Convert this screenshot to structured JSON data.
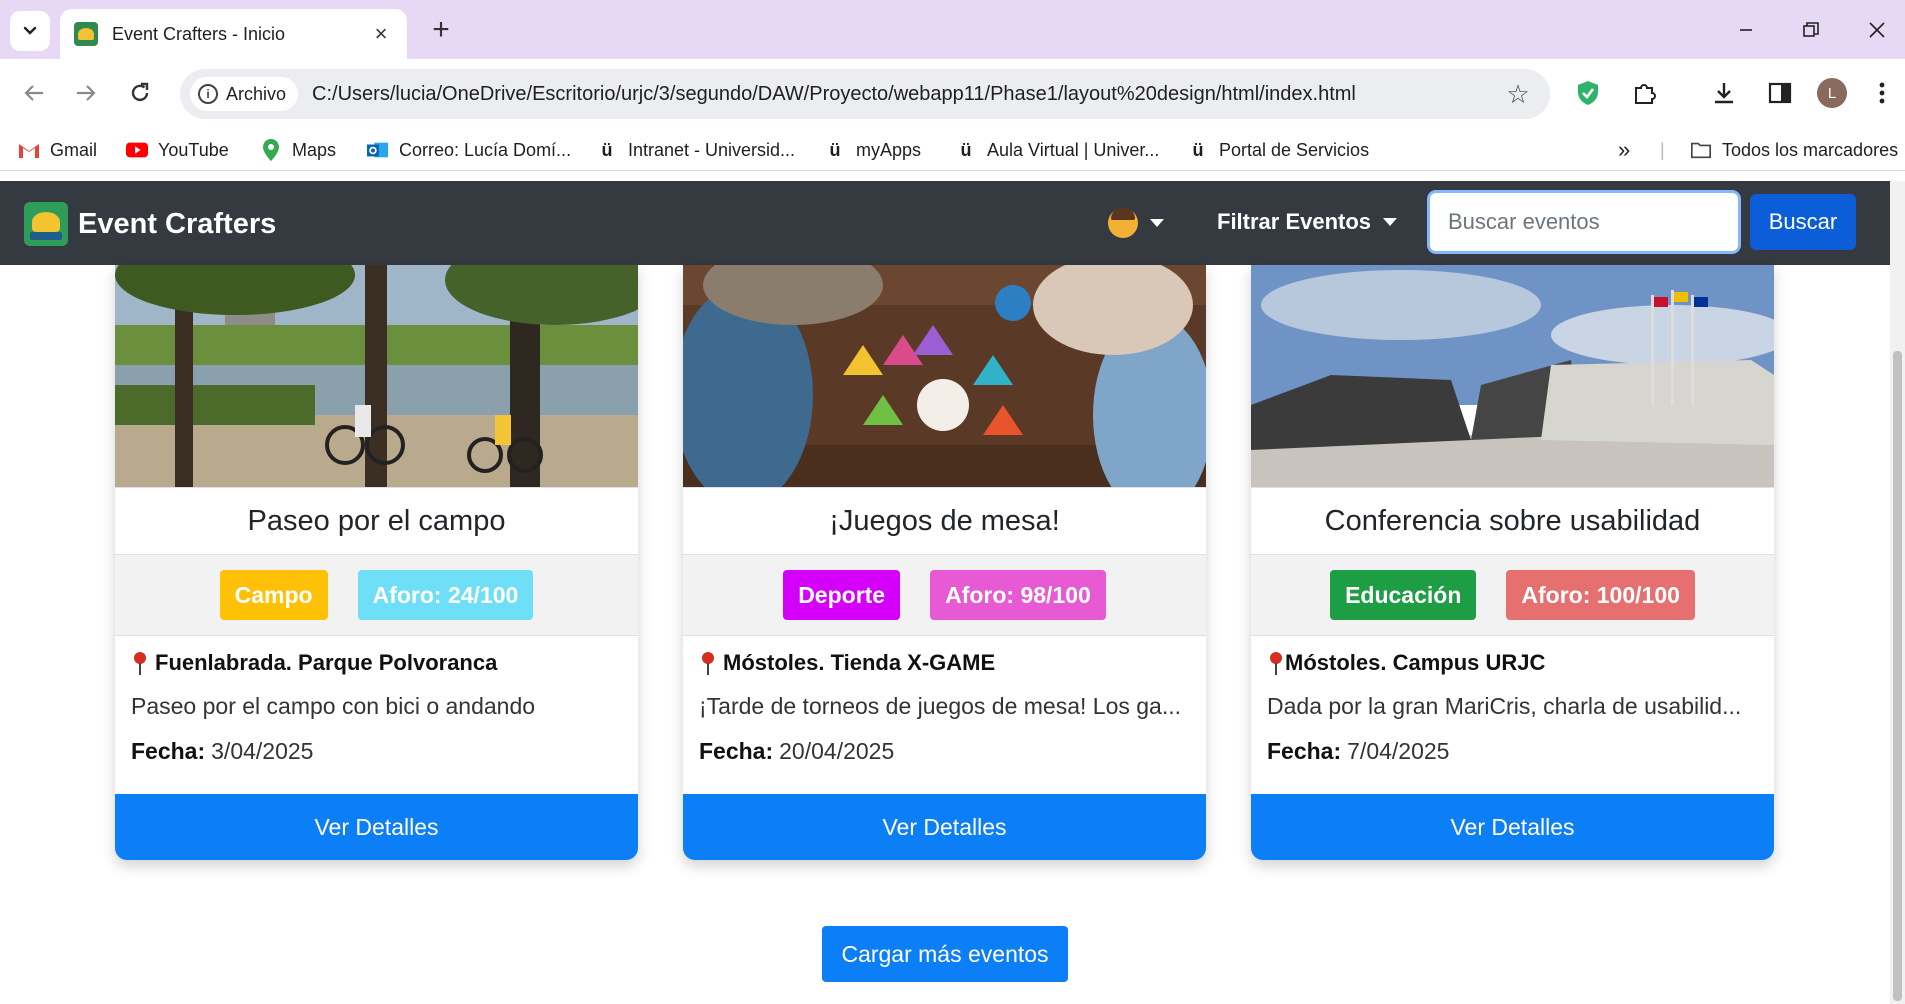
{
  "browser": {
    "tab_title": "Event Crafters - Inicio",
    "security_chip": "Archivo",
    "url": "C:/Users/lucia/OneDrive/Escritorio/urjc/3/segundo/DAW/Proyecto/webapp11/Phase1/layout%20design/html/index.html",
    "profile_initial": "L",
    "bookmarks": [
      {
        "label": "Gmail",
        "icon": "gmail-icon"
      },
      {
        "label": "YouTube",
        "icon": "youtube-icon"
      },
      {
        "label": "Maps",
        "icon": "maps-icon"
      },
      {
        "label": "Correo: Lucía Domí...",
        "icon": "outlook-icon"
      },
      {
        "label": "Intranet - Universid...",
        "icon": "urjc-icon"
      },
      {
        "label": "myApps",
        "icon": "urjc-icon"
      },
      {
        "label": "Aula Virtual | Univer...",
        "icon": "urjc-icon"
      },
      {
        "label": "Portal de Servicios",
        "icon": "urjc-icon"
      }
    ],
    "all_bookmarks": "Todos los marcadores"
  },
  "navbar": {
    "brand": "Event Crafters",
    "filter_label": "Filtrar Eventos",
    "search_placeholder": "Buscar eventos",
    "search_button": "Buscar"
  },
  "events": [
    {
      "title": "Paseo por el campo",
      "category": "Campo",
      "category_color": "#ffc107",
      "capacity": "Aforo: 24/100",
      "capacity_color": "#6edff6",
      "location": "Fuenlabrada. Parque Polvoranca",
      "description": "Paseo por el campo con bici o andando",
      "date_label": "Fecha:",
      "date": "3/04/2025",
      "button": "Ver Detalles"
    },
    {
      "title": "¡Juegos de mesa!",
      "category": "Deporte",
      "category_color": "#d500f9",
      "capacity": "Aforo: 98/100",
      "capacity_color": "#e85ad3",
      "location": "Móstoles. Tienda X-GAME",
      "description": "¡Tarde de torneos de juegos de mesa! Los ga...",
      "date_label": "Fecha:",
      "date": "20/04/2025",
      "button": "Ver Detalles"
    },
    {
      "title": "Conferencia sobre usabilidad",
      "category": "Educación",
      "category_color": "#1e9e44",
      "capacity": "Aforo: 100/100",
      "capacity_color": "#e66f6f",
      "location": "Móstoles. Campus URJC",
      "description": "Dada por la gran MariCris, charla de usabilid...",
      "date_label": "Fecha:",
      "date": "7/04/2025",
      "button": "Ver Detalles"
    }
  ],
  "load_more": "Cargar más eventos"
}
